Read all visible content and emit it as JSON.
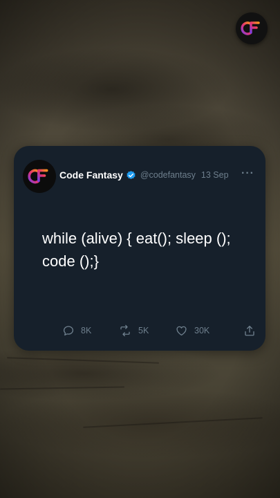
{
  "tweet": {
    "display_name": "Code Fantasy",
    "handle": "@codefantasy",
    "date": "13 Sep",
    "more": "···",
    "text": "while (alive) { eat(); sleep (); code ();}",
    "verified": true,
    "replies": "8K",
    "retweets": "5K",
    "likes": "30K"
  },
  "icons": {
    "logo": "code-fantasy-logo-icon",
    "verified": "verified-badge-icon",
    "reply": "reply-icon",
    "retweet": "retweet-icon",
    "like": "heart-icon",
    "share": "share-icon"
  },
  "colors": {
    "card_bg": "#16202b",
    "verified_blue": "#1d9bf0",
    "muted_text": "#6e7f8d",
    "logo_orange": "#f7931e",
    "logo_pink": "#e8336d",
    "logo_purple": "#7b3fe4"
  }
}
